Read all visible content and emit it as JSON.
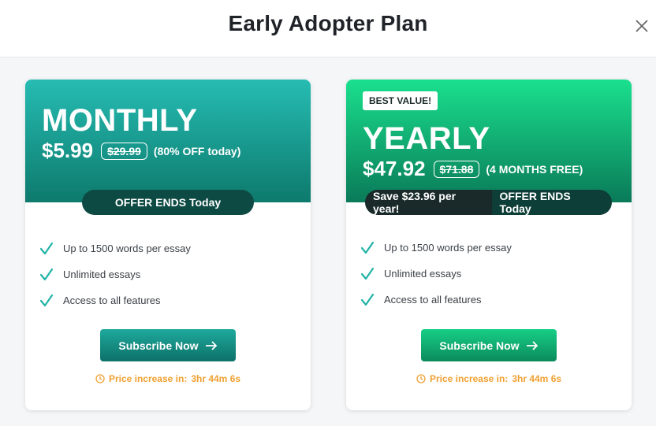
{
  "modal": {
    "title": "Early Adopter Plan",
    "close_icon": "close-icon"
  },
  "plans": [
    {
      "id": "monthly",
      "badge": "",
      "name": "MONTHLY",
      "price": "$5.99",
      "old_price": "$29.99",
      "price_note": "(80% OFF today)",
      "offer_text": "OFFER ENDS Today",
      "features": [
        "Up to 1500 words per essay",
        "Unlimited essays",
        "Access to all features"
      ],
      "subscribe_label": "Subscribe Now",
      "countdown_label": "Price increase in:",
      "countdown_value": "3hr 44m 6s"
    },
    {
      "id": "yearly",
      "badge": "BEST VALUE!",
      "name": "YEARLY",
      "price": "$47.92",
      "old_price": "$71.88",
      "price_note": "(4 MONTHS FREE)",
      "save_text": "Save $23.96 per year!",
      "offer_text": "OFFER ENDS Today",
      "features": [
        "Up to 1500 words per essay",
        "Unlimited essays",
        "Access to all features"
      ],
      "subscribe_label": "Subscribe Now",
      "countdown_label": "Price increase in:",
      "countdown_value": "3hr 44m 6s"
    }
  ],
  "colors": {
    "monthly_accent": "#1fa99d",
    "yearly_accent": "#17cf87",
    "check": "#21b3a6",
    "countdown": "#f0a030"
  },
  "icons": {
    "check": "check-icon",
    "arrow": "arrow-right-icon",
    "clock": "clock-icon"
  }
}
